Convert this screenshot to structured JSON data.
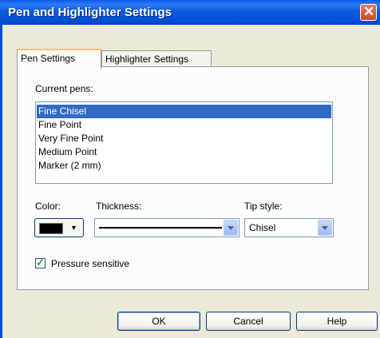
{
  "window": {
    "title": "Pen and Highlighter Settings",
    "close_glyph": "✕"
  },
  "tabs": [
    {
      "label": "Pen Settings",
      "active": true
    },
    {
      "label": "Highlighter Settings",
      "active": false
    }
  ],
  "pens": {
    "label": "Current pens:",
    "items": [
      "Fine Chisel",
      "Fine Point",
      "Very Fine Point",
      "Medium Point",
      "Marker (2 mm)"
    ],
    "selected": "Fine Chisel"
  },
  "color": {
    "label": "Color:",
    "value": "#000000"
  },
  "thickness": {
    "label": "Thickness:"
  },
  "tip_style": {
    "label": "Tip style:",
    "value": "Chisel"
  },
  "pressure": {
    "label": "Pressure sensitive",
    "checked": true
  },
  "buttons": {
    "ok": "OK",
    "cancel": "Cancel",
    "help": "Help"
  },
  "colors": {
    "titlebar": "#0A58E8",
    "selection": "#316AC5",
    "dialog_bg": "#ECE9D8",
    "tab_accent": "#FFC83C"
  }
}
